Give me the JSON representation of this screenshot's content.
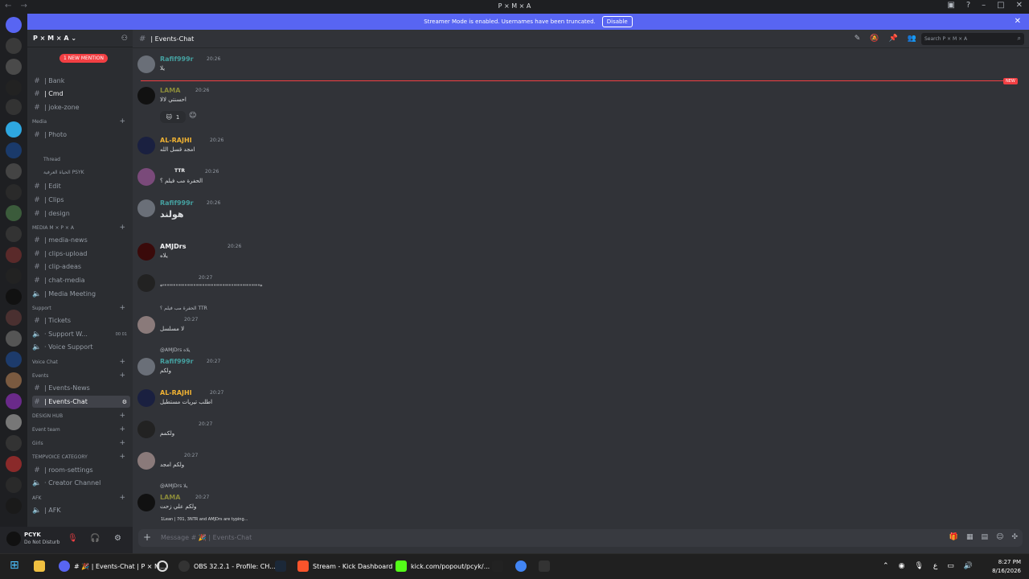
{
  "window": {
    "title": "P × M × A"
  },
  "banner": {
    "text": "Streamer Mode is enabled. Usernames have been truncated.",
    "button": "Disable"
  },
  "server": {
    "name": "P × M × A"
  },
  "sidebar": {
    "mention_pill": "1 NEW MENTION",
    "items": [
      {
        "label": "| Bank"
      },
      {
        "label": "| Cmd"
      },
      {
        "label": "| joke-zone"
      },
      {
        "label": "| Photo"
      },
      {
        "label": "Thread"
      },
      {
        "label": "الحياة العرفية PSYK"
      },
      {
        "label": "| Edit"
      },
      {
        "label": "| Clips"
      },
      {
        "label": "| design"
      },
      {
        "label": "| media-news"
      },
      {
        "label": "| clips-upload"
      },
      {
        "label": "| clip-adeas"
      },
      {
        "label": "| chat-media"
      },
      {
        "label": "| Media Meeting"
      },
      {
        "label": "| Tickets"
      },
      {
        "label": "· Support W..."
      },
      {
        "label": "· Voice Support"
      },
      {
        "label": "| Events-News"
      },
      {
        "label": "| Events-Chat"
      },
      {
        "label": "| room-settings"
      },
      {
        "label": "· Creator Channel"
      },
      {
        "label": "| AFK"
      }
    ],
    "categories": [
      {
        "label": "Media"
      },
      {
        "label": "MEDIA M × P × A"
      },
      {
        "label": "Support"
      },
      {
        "label": "Voice Chat"
      },
      {
        "label": "Events"
      },
      {
        "label": "DESIGN HUB"
      },
      {
        "label": "Event team"
      },
      {
        "label": "Girls"
      },
      {
        "label": "TEMPVOICE CATEGORY"
      },
      {
        "label": "AFK"
      }
    ],
    "voice_counts": "00 01"
  },
  "user": {
    "name": "PCYK",
    "status": "Do Not Disturb"
  },
  "channel": {
    "name": "| Events-Chat",
    "search_placeholder": "Search P × M × A"
  },
  "messages": [
    {
      "author": "Rafif999r",
      "time": "20:26",
      "text": "يلا",
      "color": "#45a0a0"
    },
    {
      "author": "LAMA",
      "time": "20:26",
      "text": "احسنتي لالا",
      "color": "#8a8a3a"
    },
    {
      "author": "AL-RAJHI",
      "time": "20:26",
      "text": "امجد قسل الله",
      "color": "#f0b232"
    },
    {
      "author": "TTR",
      "time": "20:26",
      "text": "الحفرة مب فيلم ؟",
      "color": "#f2f3f5"
    },
    {
      "author": "Rafif999r",
      "time": "20:26",
      "text": "هولند",
      "color": "#45a0a0"
    },
    {
      "author": "AMJDrs",
      "time": "20:26",
      "text": "يلاه",
      "color": "#f2f3f5"
    },
    {
      "author": "",
      "time": "20:27",
      "text": "*\"\"\"\"\"\"\"\"\"\"\"\"\"\"\"\"\"\"\"\"\"\"\"\"\"\"\"\"\"\"\"\"\"\"\"\"\"\"\"\"\"\"\"\"*",
      "color": "#f2f3f5"
    },
    {
      "author": "",
      "time": "20:27",
      "text": "لا مسلسل",
      "color": "#f2f3f5",
      "reply": "الحفرة مب فيلم ؟  TTR"
    },
    {
      "author": "Rafif999r",
      "time": "20:27",
      "text": "ولكم",
      "color": "#45a0a0",
      "reply": "@AMJDrs  يلاه"
    },
    {
      "author": "AL-RAJHI",
      "time": "20:27",
      "text": "اطلب تيريات مستطيل",
      "color": "#f0b232"
    },
    {
      "author": "",
      "time": "20:27",
      "text": "ولكمم",
      "color": "#f2f3f5"
    },
    {
      "author": "",
      "time": "20:27",
      "text": "ولكم امجد",
      "color": "#f2f3f5"
    },
    {
      "author": "LAMA",
      "time": "20:27",
      "text": "ولكم علي زحت",
      "color": "#8a8a3a",
      "reply": "@AMJDrs  يلا"
    }
  ],
  "reaction": {
    "count": "1"
  },
  "new_tag": "NEW",
  "typing": "1Lean | 701, 3NTR and AMJDrs are typing...",
  "composer": {
    "placeholder": "Message # 🎉 | Events-Chat"
  },
  "taskbar": {
    "items": [
      {
        "label": "# 🎉 | Events-Chat | P × M..."
      },
      {
        "label": "OBS 32.2.1 - Profile: CH..."
      },
      {
        "label": "Stream - Kick Dashboard"
      },
      {
        "label": "kick.com/popout/pcyk/..."
      }
    ],
    "time": "8:27 PM",
    "date": "8/16/2026"
  }
}
